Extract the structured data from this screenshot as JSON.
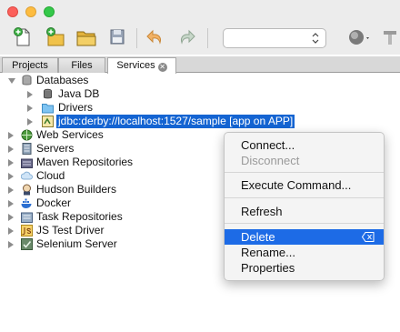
{
  "tabs": [
    {
      "label": "Projects"
    },
    {
      "label": "Files"
    },
    {
      "label": "Services"
    }
  ],
  "tree": [
    {
      "label": "Databases",
      "icon": "database-icon",
      "state": "expanded"
    },
    {
      "label": "Java DB",
      "icon": "java-db-icon",
      "state": "collapsed"
    },
    {
      "label": "Drivers",
      "icon": "folder-icon",
      "state": "collapsed"
    },
    {
      "label": "jdbc:derby://localhost:1527/sample [app on APP]",
      "icon": "db-connection-icon",
      "state": "collapsed",
      "selected": true
    },
    {
      "label": "Web Services",
      "icon": "web-services-icon",
      "state": "collapsed"
    },
    {
      "label": "Servers",
      "icon": "servers-icon",
      "state": "collapsed"
    },
    {
      "label": "Maven Repositories",
      "icon": "maven-icon",
      "state": "collapsed"
    },
    {
      "label": "Cloud",
      "icon": "cloud-icon",
      "state": "collapsed"
    },
    {
      "label": "Hudson Builders",
      "icon": "hudson-icon",
      "state": "collapsed"
    },
    {
      "label": "Docker",
      "icon": "docker-icon",
      "state": "collapsed"
    },
    {
      "label": "Task Repositories",
      "icon": "task-repo-icon",
      "state": "collapsed"
    },
    {
      "label": "JS Test Driver",
      "icon": "js-test-driver-icon",
      "state": "collapsed"
    },
    {
      "label": "Selenium Server",
      "icon": "selenium-icon",
      "state": "collapsed"
    }
  ],
  "context_menu": {
    "items": [
      {
        "label": "Connect...",
        "enabled": true
      },
      {
        "label": "Disconnect",
        "enabled": false
      },
      {
        "label": "Execute Command...",
        "enabled": true
      },
      {
        "label": "Refresh",
        "enabled": true
      },
      {
        "label": "Delete",
        "enabled": true,
        "highlighted": true,
        "shortcut_icon": "delete-key-icon"
      },
      {
        "label": "Rename...",
        "enabled": true
      },
      {
        "label": "Properties",
        "enabled": true
      }
    ]
  },
  "colors": {
    "selection": "#1464d2",
    "menu_highlight": "#1d6be6",
    "window_bg": "#ececec"
  }
}
